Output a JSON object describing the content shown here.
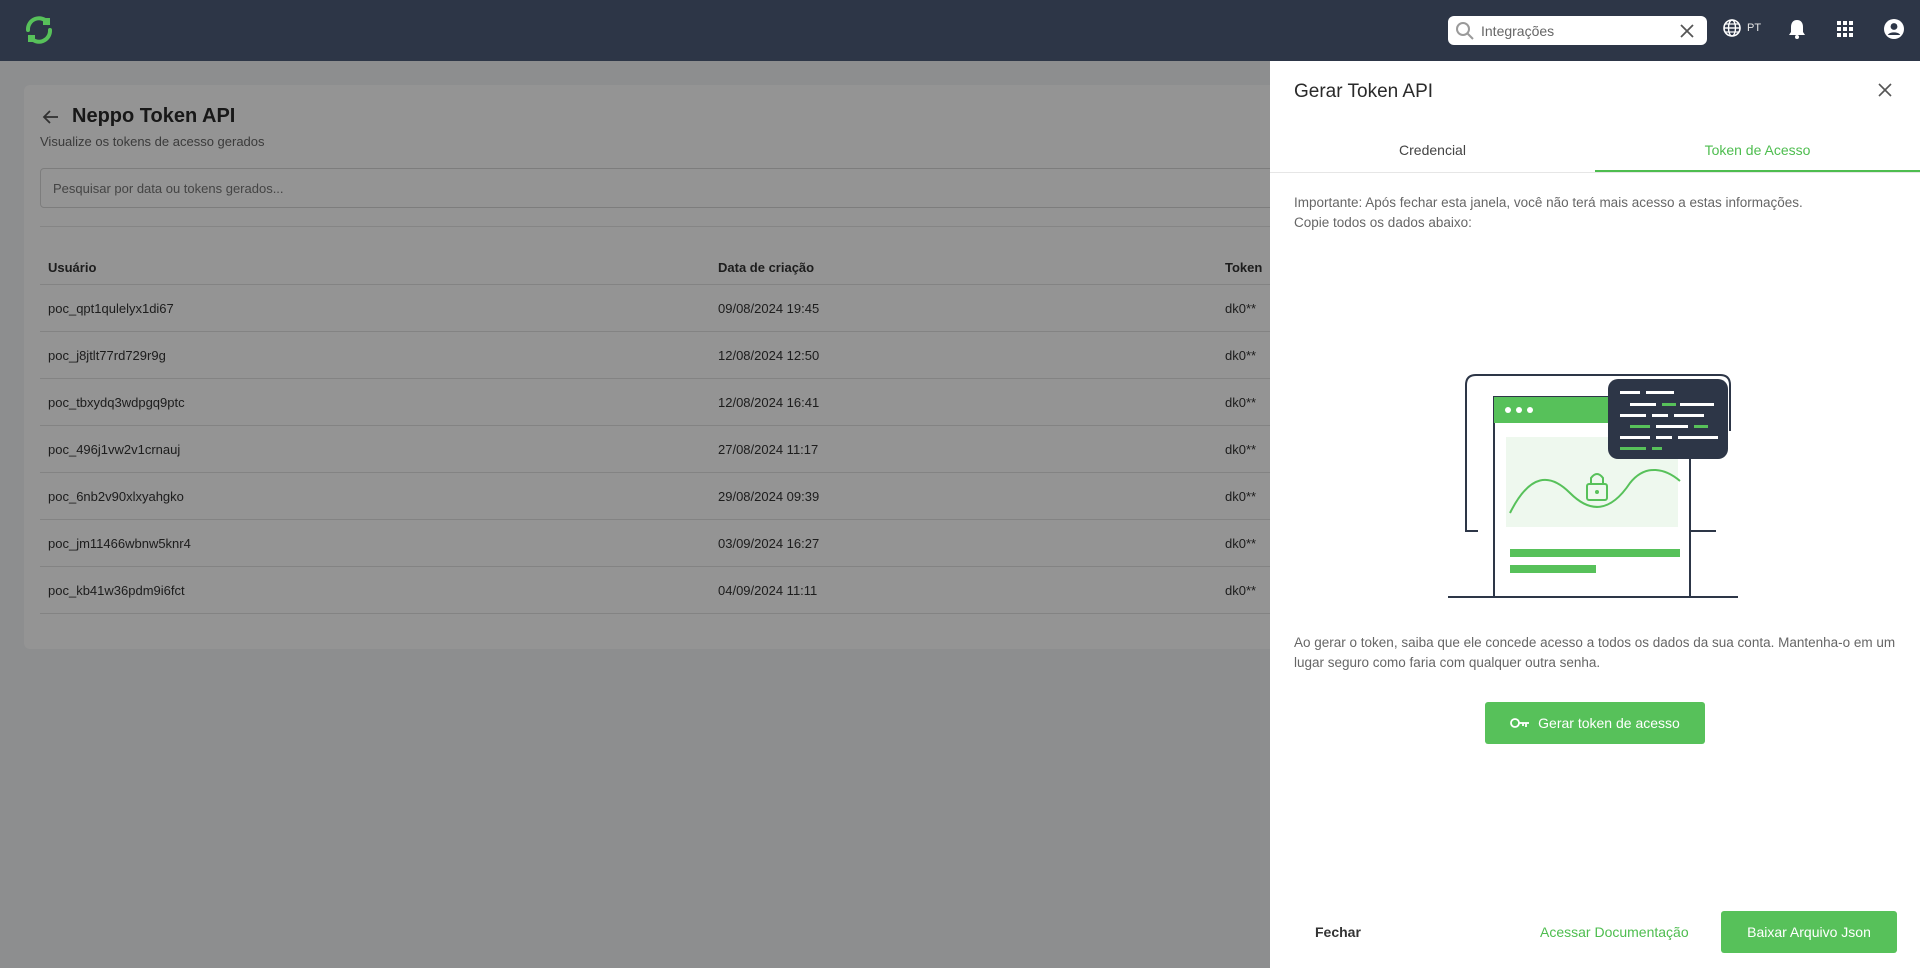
{
  "topbar": {
    "search_value": "Integrações",
    "lang_code": "PT"
  },
  "page": {
    "title": "Neppo Token API",
    "subtitle": "Visualize os tokens de acesso gerados",
    "search_placeholder": "Pesquisar por data ou tokens gerados...",
    "columns": [
      "Usuário",
      "Data de criação",
      "Token"
    ],
    "rows": [
      {
        "user": "poc_qpt1qulelyx1di67",
        "date": "09/08/2024 19:45",
        "token": "dk0**"
      },
      {
        "user": "poc_j8jtlt77rd729r9g",
        "date": "12/08/2024 12:50",
        "token": "dk0**"
      },
      {
        "user": "poc_tbxydq3wdpgq9ptc",
        "date": "12/08/2024 16:41",
        "token": "dk0**"
      },
      {
        "user": "poc_496j1vw2v1crnauj",
        "date": "27/08/2024 11:17",
        "token": "dk0**"
      },
      {
        "user": "poc_6nb2v90xlxyahgko",
        "date": "29/08/2024 09:39",
        "token": "dk0**"
      },
      {
        "user": "poc_jm11466wbnw5knr4",
        "date": "03/09/2024 16:27",
        "token": "dk0**"
      },
      {
        "user": "poc_kb41w36pdm9i6fct",
        "date": "04/09/2024 11:11",
        "token": "dk0**"
      }
    ]
  },
  "drawer": {
    "title": "Gerar Token API",
    "tabs": [
      {
        "label": "Credencial",
        "active": false
      },
      {
        "label": "Token de Acesso",
        "active": true
      }
    ],
    "info_line1": "Importante: Após fechar esta janela, você não terá mais acesso a estas informações.",
    "info_line2": "Copie todos os dados abaixo:",
    "warning": "Ao gerar o token, saiba que ele concede acesso a todos os dados da sua conta. Mantenha-o em um lugar seguro como faria com qualquer outra senha.",
    "generate_label": "Gerar token de acesso",
    "close_label": "Fechar",
    "docs_label": "Acessar Documentação",
    "download_label": "Baixar Arquivo Json"
  },
  "colors": {
    "accent": "#4ebd4f",
    "topbar": "#2d3647"
  },
  "icons": [
    "logo-icon",
    "search-icon",
    "clear-icon",
    "globe-icon",
    "bell-icon",
    "apps-grid-icon",
    "account-icon",
    "back-arrow-icon",
    "close-icon",
    "key-icon"
  ]
}
